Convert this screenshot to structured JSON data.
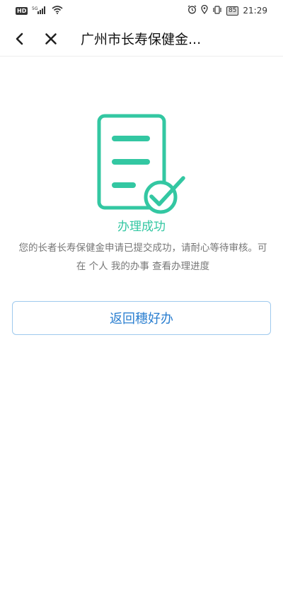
{
  "status_bar": {
    "left_badge": "HD",
    "network": "5G",
    "battery": "85",
    "time": "21:29"
  },
  "nav": {
    "title": "广州市长寿保健金..."
  },
  "result": {
    "title": "办理成功",
    "message": "您的长者长寿保健金申请已提交成功，请耐心等待审核。可在 个人 我的办事 查看办理进度"
  },
  "actions": {
    "return_label": "返回穗好办"
  },
  "colors": {
    "accent_green": "#33c7a2",
    "button_text_blue": "#2b7fd0",
    "button_border": "#9ec9ee"
  }
}
